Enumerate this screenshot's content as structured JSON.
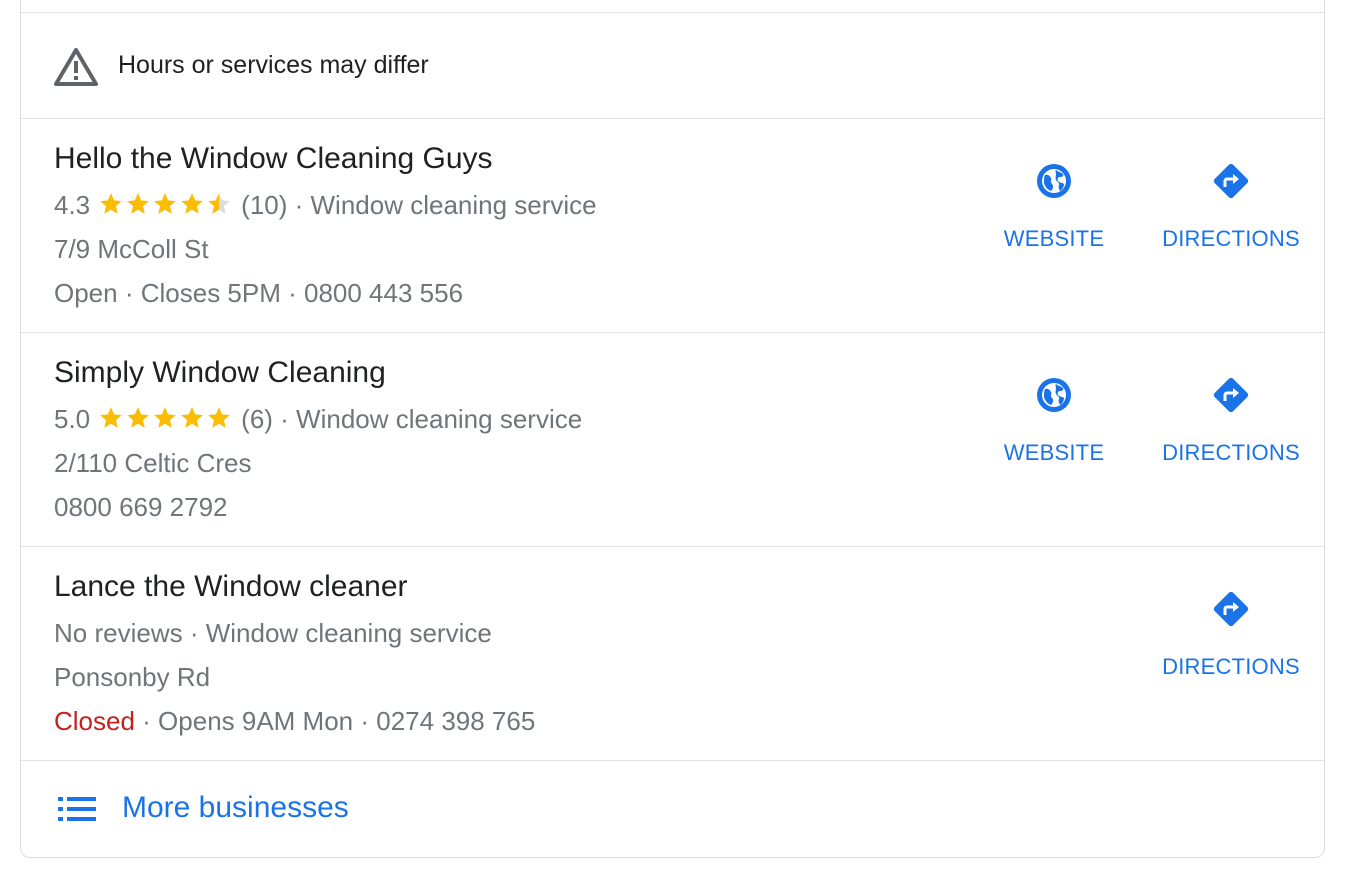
{
  "notice": {
    "icon": "warning-triangle-icon",
    "text": "Hours or services may differ"
  },
  "colors": {
    "accent": "#1a73e8",
    "star": "#fbbc04",
    "closed": "#c5221f",
    "text_secondary": "#70757a"
  },
  "businesses": [
    {
      "name": "Hello the Window Cleaning Guys",
      "rating": "4.3",
      "rating_value": 4.3,
      "stars_filled": 4.5,
      "reviews": "(10)",
      "category": "Window cleaning service",
      "address": "7/9 McColl St",
      "status": "Open",
      "hours": "Closes 5PM",
      "phone": "0800 443 556",
      "website_label": "WEBSITE",
      "directions_label": "DIRECTIONS"
    },
    {
      "name": "Simply Window Cleaning",
      "rating": "5.0",
      "rating_value": 5.0,
      "stars_filled": 5,
      "reviews": "(6)",
      "category": "Window cleaning service",
      "address": "2/110 Celtic Cres",
      "phone": "0800 669 2792",
      "website_label": "WEBSITE",
      "directions_label": "DIRECTIONS"
    },
    {
      "name": "Lance the Window cleaner",
      "reviews_text": "No reviews",
      "category": "Window cleaning service",
      "address": "Ponsonby Rd",
      "status": "Closed",
      "hours": "Opens 9AM Mon",
      "phone": "0274 398 765",
      "directions_label": "DIRECTIONS"
    }
  ],
  "more": {
    "icon": "list-icon",
    "label": "More businesses"
  }
}
